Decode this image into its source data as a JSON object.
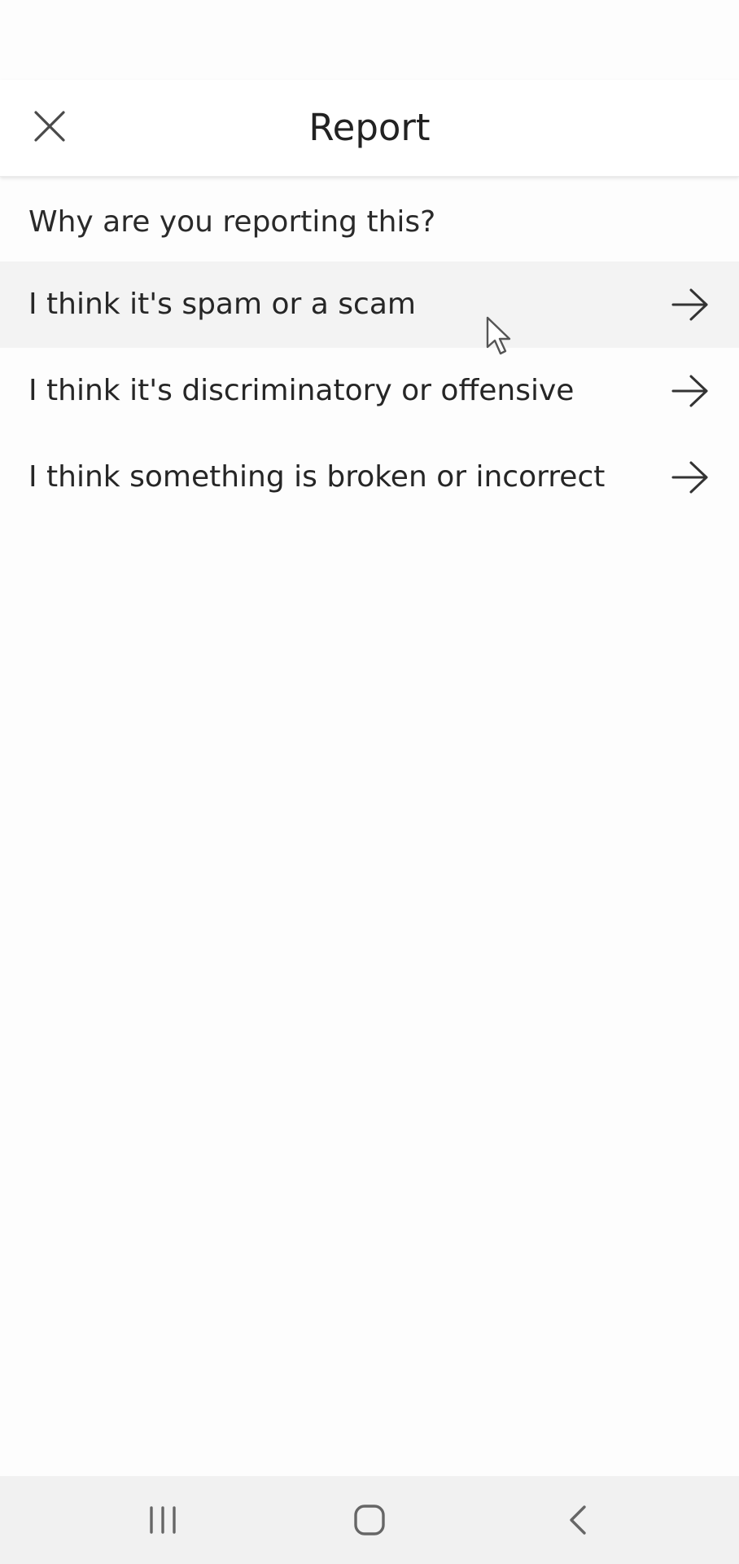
{
  "header": {
    "title": "Report",
    "close_icon": "close-icon"
  },
  "prompt": "Why are you reporting this?",
  "reasons": [
    {
      "label": "I think it's spam or a scam",
      "icon": "arrow-right-icon",
      "highlighted": true
    },
    {
      "label": "I think it's discriminatory or offensive",
      "icon": "arrow-right-icon",
      "highlighted": false
    },
    {
      "label": "I think something is broken or incorrect",
      "icon": "arrow-right-icon",
      "highlighted": false
    }
  ],
  "nav_bar": {
    "recents_icon": "recent-apps-icon",
    "home_icon": "home-icon",
    "back_icon": "back-icon"
  },
  "colors": {
    "background": "#fdfdfd",
    "highlight_row": "#f3f3f3",
    "nav_bar": "#f1f1f1",
    "text": "#262626"
  }
}
